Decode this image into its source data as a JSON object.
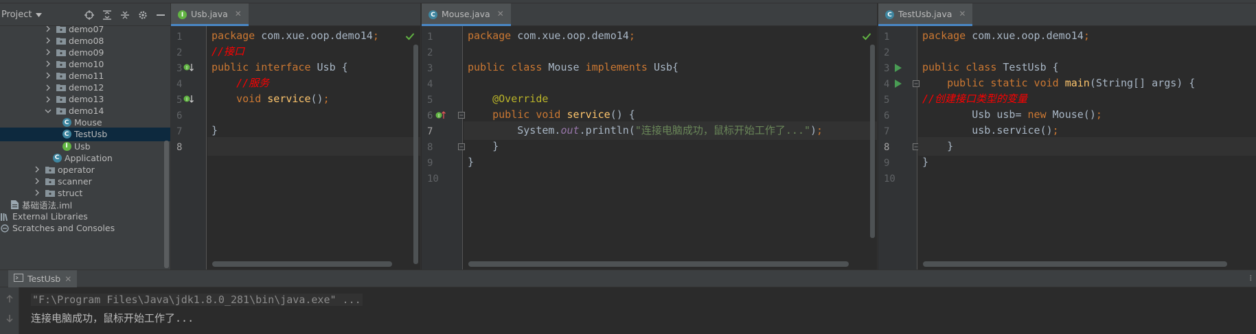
{
  "project": {
    "title": "Project",
    "tree": [
      {
        "label": "demo07",
        "kind": "folder",
        "level": 1,
        "expanded": false
      },
      {
        "label": "demo08",
        "kind": "folder",
        "level": 1,
        "expanded": false
      },
      {
        "label": "demo09",
        "kind": "folder",
        "level": 1,
        "expanded": false
      },
      {
        "label": "demo10",
        "kind": "folder",
        "level": 1,
        "expanded": false
      },
      {
        "label": "demo11",
        "kind": "folder",
        "level": 1,
        "expanded": false
      },
      {
        "label": "demo12",
        "kind": "folder",
        "level": 1,
        "expanded": false
      },
      {
        "label": "demo13",
        "kind": "folder",
        "level": 1,
        "expanded": false
      },
      {
        "label": "demo14",
        "kind": "folder",
        "level": 1,
        "expanded": true
      },
      {
        "label": "Mouse",
        "kind": "class",
        "level": 2
      },
      {
        "label": "TestUsb",
        "kind": "class",
        "level": 2,
        "selected": true
      },
      {
        "label": "Usb",
        "kind": "interface",
        "level": 2
      },
      {
        "label": "Application",
        "kind": "class",
        "level": 1.5
      },
      {
        "label": "operator",
        "kind": "folder",
        "level": 0,
        "expanded": false
      },
      {
        "label": "scanner",
        "kind": "folder",
        "level": 0,
        "expanded": false
      },
      {
        "label": "struct",
        "kind": "folder",
        "level": 0,
        "expanded": false
      },
      {
        "label": "基础语法.iml",
        "kind": "file",
        "level": -1
      },
      {
        "label": "External Libraries",
        "kind": "lib",
        "level": -2
      },
      {
        "label": "Scratches and Consoles",
        "kind": "scratch",
        "level": -2
      }
    ]
  },
  "editors": [
    {
      "tab": "Usb.java",
      "icon": "interface-icon",
      "line_count": 8,
      "current_line": 8,
      "lines": [
        [
          [
            "kw",
            "package "
          ],
          [
            "id",
            "com.xue.oop.demo14"
          ],
          [
            "kw",
            ";"
          ]
        ],
        [
          [
            "cm",
            "//接口"
          ]
        ],
        [
          [
            "kw",
            "public interface "
          ],
          [
            "id",
            "Usb {"
          ]
        ],
        [
          [
            "id",
            "    "
          ],
          [
            "cm",
            "//服务"
          ]
        ],
        [
          [
            "id",
            "    "
          ],
          [
            "kw",
            "void "
          ],
          [
            "fn",
            "service"
          ],
          [
            "id",
            "()"
          ],
          [
            "kw",
            ";"
          ]
        ],
        [],
        [
          [
            "id",
            "}"
          ]
        ],
        []
      ]
    },
    {
      "tab": "Mouse.java",
      "icon": "class-icon",
      "line_count": 10,
      "current_line": 7,
      "lines": [
        [
          [
            "kw",
            "package "
          ],
          [
            "id",
            "com.xue.oop.demo14"
          ],
          [
            "kw",
            ";"
          ]
        ],
        [],
        [
          [
            "kw",
            "public class "
          ],
          [
            "id",
            "Mouse "
          ],
          [
            "kw",
            "implements "
          ],
          [
            "id",
            "Usb{"
          ]
        ],
        [],
        [
          [
            "id",
            "    "
          ],
          [
            "an",
            "@Override"
          ]
        ],
        [
          [
            "id",
            "    "
          ],
          [
            "kw",
            "public void "
          ],
          [
            "fn",
            "service"
          ],
          [
            "id",
            "() {"
          ]
        ],
        [
          [
            "id",
            "        System."
          ],
          [
            "sf",
            "out"
          ],
          [
            "id",
            ".println("
          ],
          [
            "st",
            "\"连接电脑成功，鼠标开始工作了...\""
          ],
          [
            "id",
            ")"
          ],
          [
            "kw",
            ";"
          ]
        ],
        [
          [
            "id",
            "    }"
          ]
        ],
        [
          [
            "id",
            "}"
          ]
        ],
        []
      ]
    },
    {
      "tab": "TestUsb.java",
      "icon": "class-icon",
      "line_count": 10,
      "current_line": 8,
      "lines": [
        [
          [
            "kw",
            "package "
          ],
          [
            "id",
            "com.xue.oop.demo14"
          ],
          [
            "kw",
            ";"
          ]
        ],
        [],
        [
          [
            "kw",
            "public class "
          ],
          [
            "id",
            "TestUsb {"
          ]
        ],
        [
          [
            "id",
            "    "
          ],
          [
            "kw",
            "public static void "
          ],
          [
            "fn",
            "main"
          ],
          [
            "id",
            "(String[] args) {"
          ]
        ],
        [
          [
            "cm",
            "//创建接口类型的变量"
          ]
        ],
        [
          [
            "id",
            "        Usb usb= "
          ],
          [
            "kw",
            "new "
          ],
          [
            "id",
            "Mouse()"
          ],
          [
            "kw",
            ";"
          ]
        ],
        [
          [
            "id",
            "        usb.service()"
          ],
          [
            "kw",
            ";"
          ]
        ],
        [
          [
            "id",
            "    }"
          ]
        ],
        [
          [
            "id",
            "}"
          ]
        ],
        []
      ]
    }
  ],
  "run": {
    "tab": "TestUsb",
    "command": "\"F:\\Program Files\\Java\\jdk1.8.0_281\\bin\\java.exe\" ...",
    "output": "连接电脑成功，鼠标开始工作了..."
  },
  "colors": {
    "keyword": "#cc7832",
    "identifier": "#a9b7c6",
    "comment": "#ff0000",
    "method": "#ffc66d",
    "annotation": "#bbb529",
    "string": "#6a8759",
    "static_field": "#9876aa"
  }
}
